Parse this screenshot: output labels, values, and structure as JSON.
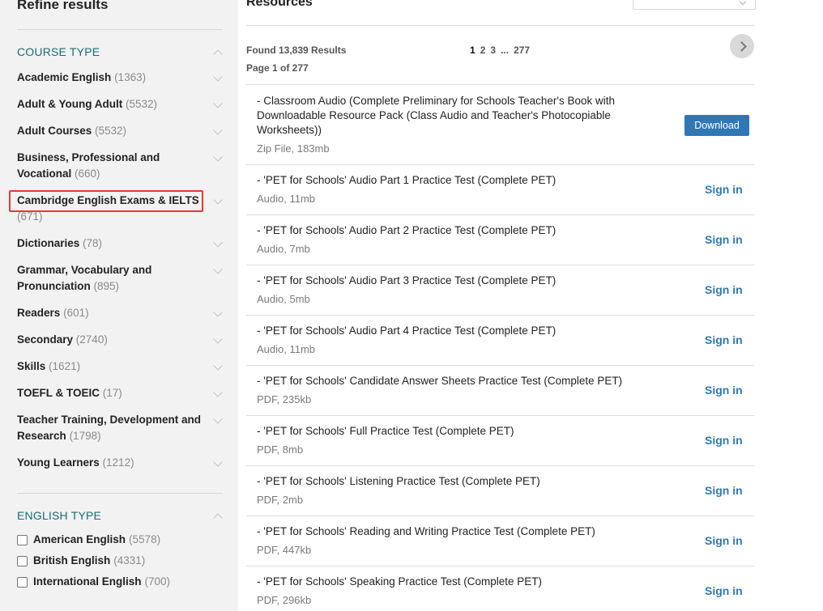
{
  "sidebar": {
    "title": "Refine results",
    "course_type": {
      "heading": "COURSE TYPE",
      "items": [
        {
          "label": "Academic English",
          "count": "(1363)"
        },
        {
          "label": "Adult & Young Adult",
          "count": "(5532)"
        },
        {
          "label": "Adult Courses",
          "count": "(5532)"
        },
        {
          "label": "Business, Professional and Vocational",
          "count": "(660)"
        },
        {
          "label": "Cambridge English Exams & IELTS",
          "count": "(671)"
        },
        {
          "label": "Dictionaries",
          "count": "(78)"
        },
        {
          "label": "Grammar, Vocabulary and Pronunciation",
          "count": "(895)"
        },
        {
          "label": "Readers",
          "count": "(601)"
        },
        {
          "label": "Secondary",
          "count": "(2740)"
        },
        {
          "label": "Skills",
          "count": "(1621)"
        },
        {
          "label": "TOEFL & TOEIC",
          "count": "(17)"
        },
        {
          "label": "Teacher Training, Development and Research",
          "count": "(1798)"
        },
        {
          "label": "Young Learners",
          "count": "(1212)"
        }
      ]
    },
    "english_type": {
      "heading": "ENGLISH TYPE",
      "items": [
        {
          "label": "American English",
          "count": "(5578)"
        },
        {
          "label": "British English",
          "count": "(4331)"
        },
        {
          "label": "International English",
          "count": "(700)"
        }
      ]
    }
  },
  "main": {
    "title": "Resources",
    "found": "Found 13,839 Results",
    "page_of": "Page 1 of 277",
    "pagination": {
      "current": "1",
      "p2": "2",
      "p3": "3",
      "ellipsis": "...",
      "last": "277"
    },
    "download_label": "Download",
    "signin_label": "Sign in",
    "results": [
      {
        "title": "- Classroom Audio (Complete Preliminary for Schools Teacher's Book with Downloadable Resource Pack (Class Audio and Teacher's Photocopiable Worksheets))",
        "meta": "Zip File, 183mb"
      },
      {
        "title": "- 'PET for Schools' Audio Part 1 Practice Test (Complete PET)",
        "meta": "Audio, 11mb"
      },
      {
        "title": "- 'PET for Schools' Audio Part 2 Practice Test (Complete PET)",
        "meta": "Audio, 7mb"
      },
      {
        "title": "- 'PET for Schools' Audio Part 3 Practice Test (Complete PET)",
        "meta": "Audio, 5mb"
      },
      {
        "title": "- 'PET for Schools' Audio Part 4 Practice Test (Complete PET)",
        "meta": "Audio, 11mb"
      },
      {
        "title": "- 'PET for Schools' Candidate Answer Sheets Practice Test (Complete PET)",
        "meta": "PDF, 235kb"
      },
      {
        "title": "- 'PET for Schools' Full Practice Test (Complete PET)",
        "meta": "PDF, 8mb"
      },
      {
        "title": "- 'PET for Schools' Listening Practice Test (Complete PET)",
        "meta": "PDF, 2mb"
      },
      {
        "title": "- 'PET for Schools' Reading and Writing Practice Test (Complete PET)",
        "meta": "PDF, 447kb"
      },
      {
        "title": "- 'PET for Schools' Speaking Practice Test (Complete PET)",
        "meta": "PDF, 296kb"
      }
    ]
  }
}
